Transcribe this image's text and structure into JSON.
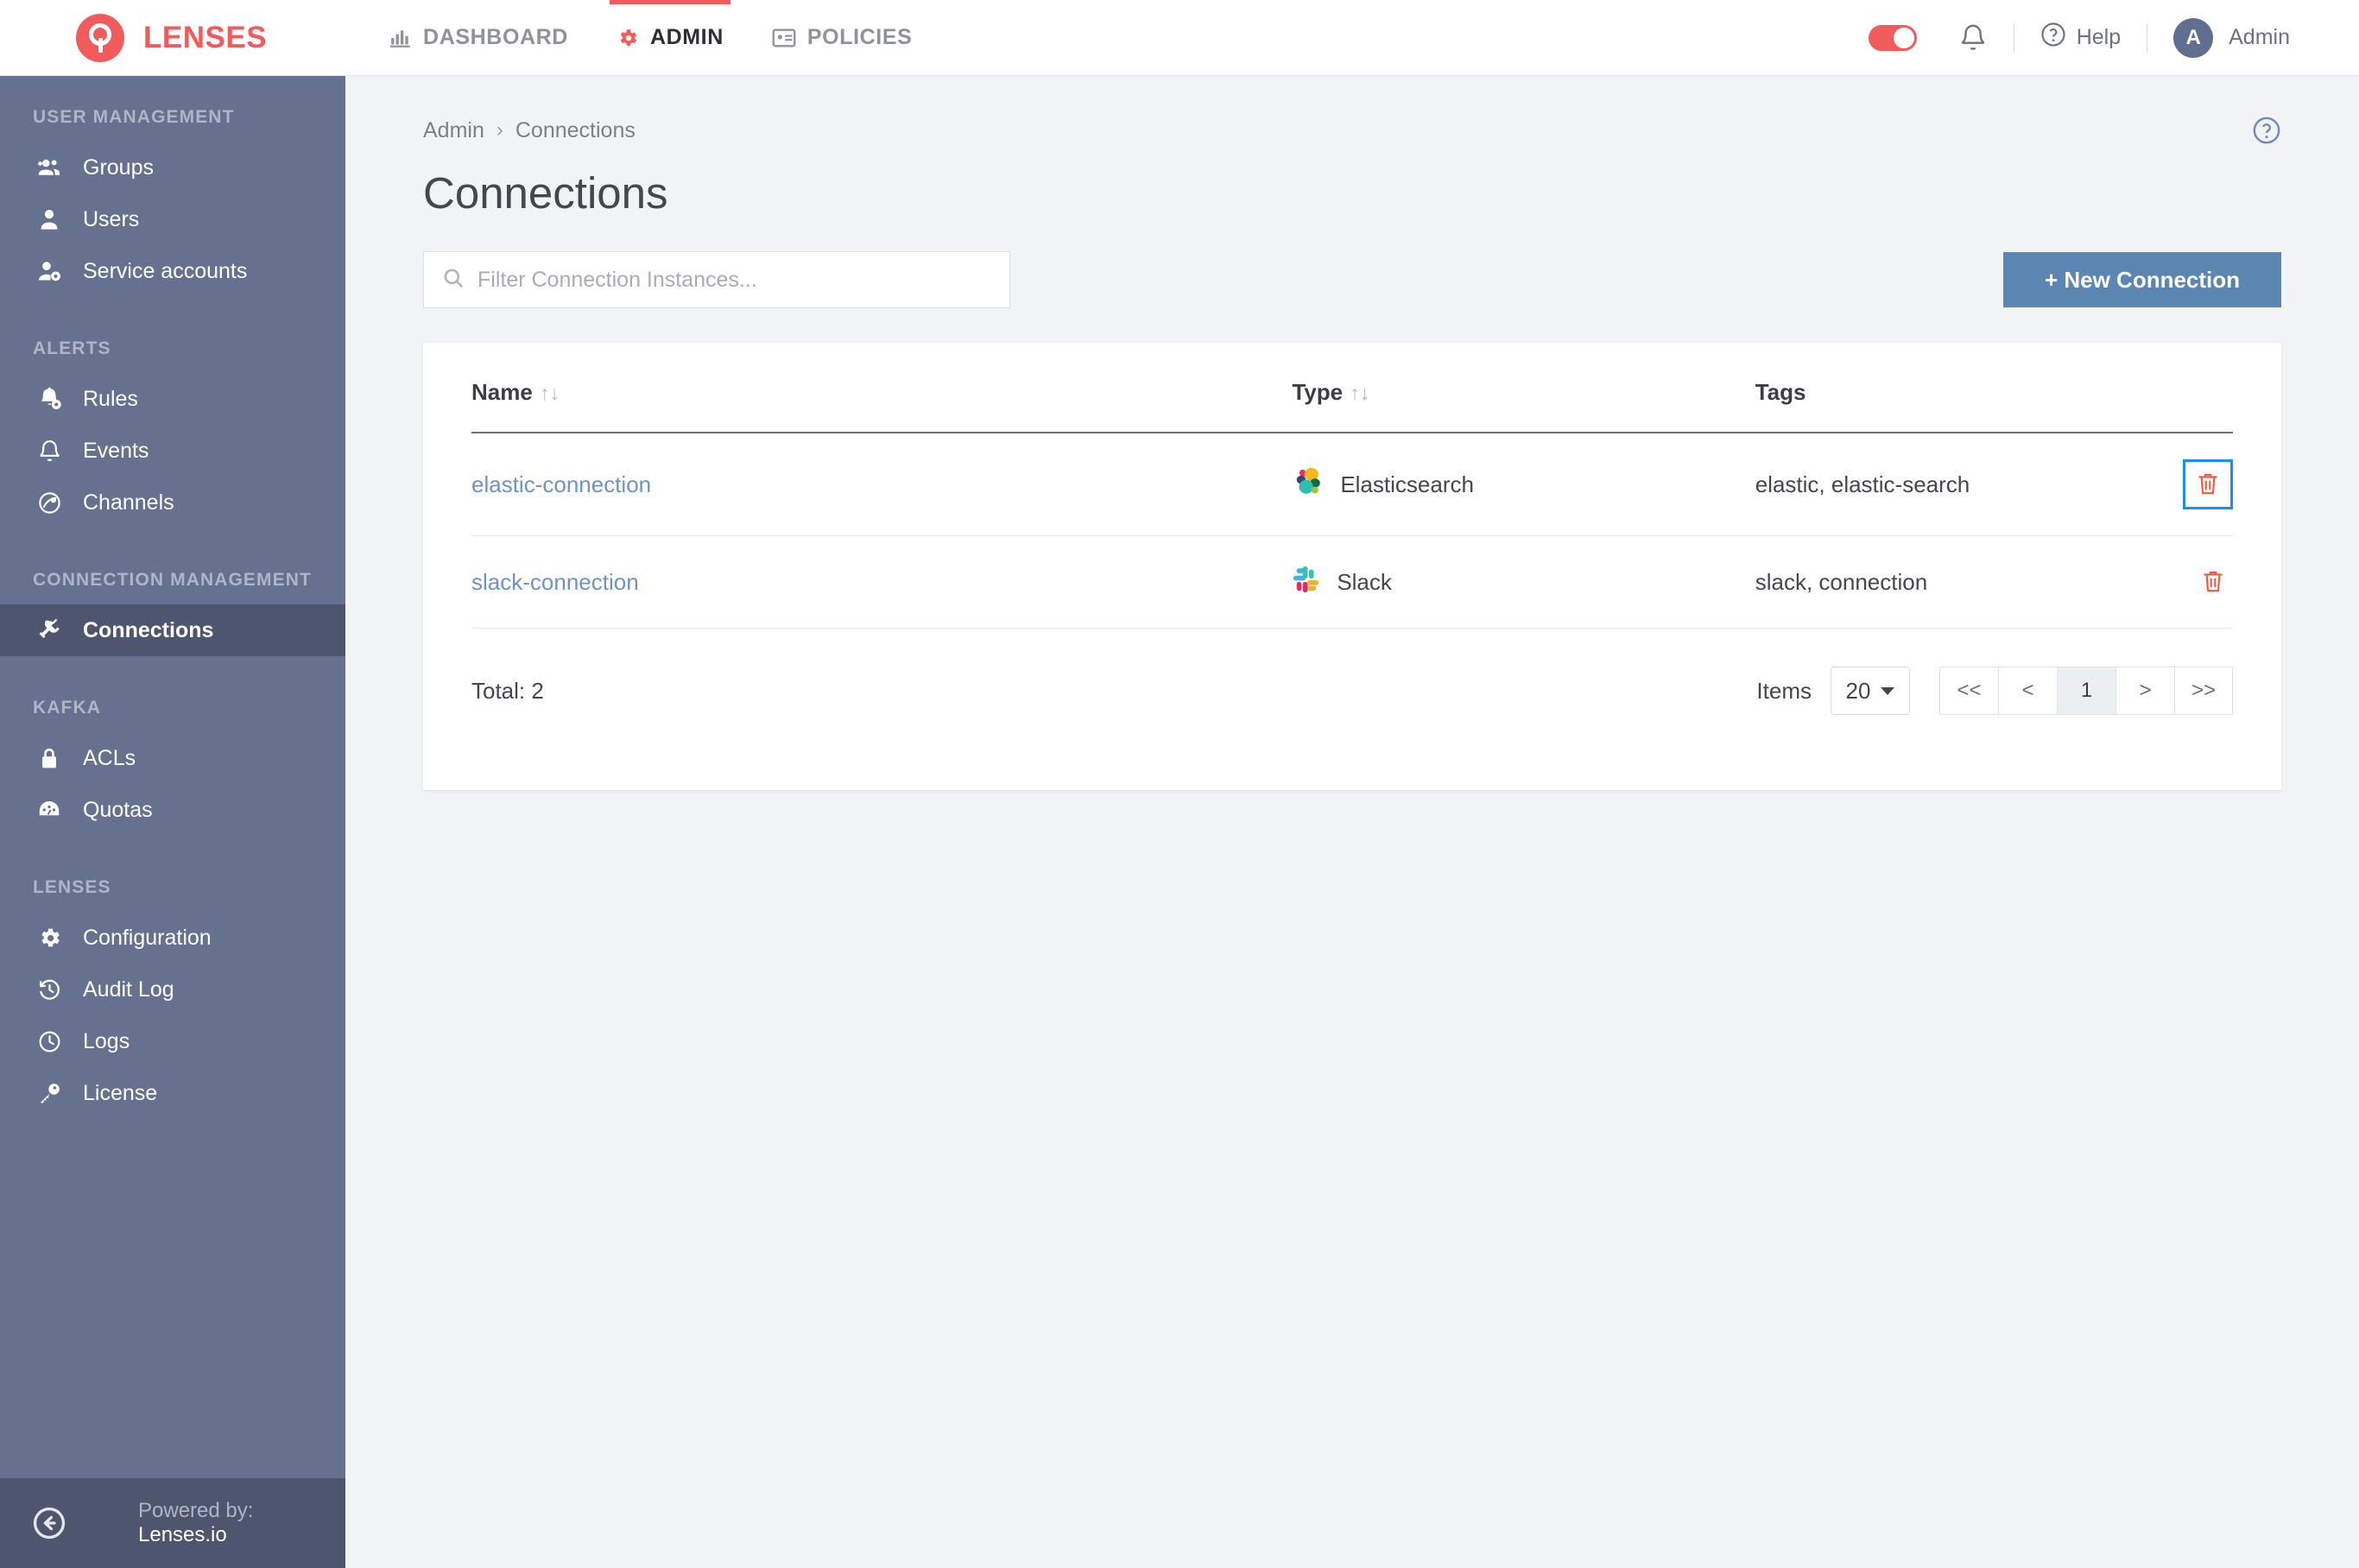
{
  "topbar": {
    "brand": "LENSES",
    "nav": [
      {
        "label": "DASHBOARD",
        "icon": "chart-bar-icon",
        "active": false
      },
      {
        "label": "ADMIN",
        "icon": "gear-icon",
        "active": true
      },
      {
        "label": "POLICIES",
        "icon": "id-card-icon",
        "active": false
      }
    ],
    "help_label": "Help",
    "user_initial": "A",
    "user_name": "Admin",
    "accent_color": "#f15b5b"
  },
  "sidebar": {
    "groups": [
      {
        "title": "USER MANAGEMENT",
        "items": [
          {
            "label": "Groups",
            "icon": "users-group-icon",
            "active": false
          },
          {
            "label": "Users",
            "icon": "user-icon",
            "active": false
          },
          {
            "label": "Service accounts",
            "icon": "user-gear-icon",
            "active": false
          }
        ]
      },
      {
        "title": "ALERTS",
        "items": [
          {
            "label": "Rules",
            "icon": "bell-gear-icon",
            "active": false
          },
          {
            "label": "Events",
            "icon": "bell-icon",
            "active": false
          },
          {
            "label": "Channels",
            "icon": "channels-icon",
            "active": false
          }
        ]
      },
      {
        "title": "CONNECTION MANAGEMENT",
        "items": [
          {
            "label": "Connections",
            "icon": "plug-icon",
            "active": true
          }
        ]
      },
      {
        "title": "KAFKA",
        "items": [
          {
            "label": "ACLs",
            "icon": "lock-icon",
            "active": false
          },
          {
            "label": "Quotas",
            "icon": "gauge-icon",
            "active": false
          }
        ]
      },
      {
        "title": "LENSES",
        "items": [
          {
            "label": "Configuration",
            "icon": "gear-icon",
            "active": false
          },
          {
            "label": "Audit Log",
            "icon": "history-icon",
            "active": false
          },
          {
            "label": "Logs",
            "icon": "clock-icon",
            "active": false
          },
          {
            "label": "License",
            "icon": "key-icon",
            "active": false
          }
        ]
      }
    ],
    "footer": {
      "collapse_icon": "collapse-left-icon",
      "powered_prefix": "Powered by: ",
      "powered_brand": "Lenses.io"
    },
    "bg_color": "#667190",
    "active_color": "#4d566e"
  },
  "main": {
    "breadcrumb": [
      "Admin",
      "Connections"
    ],
    "breadcrumb_separator": "›",
    "page_help_icon": "question-circle-icon",
    "title": "Connections",
    "search": {
      "icon": "search-icon",
      "placeholder": "Filter Connection Instances...",
      "value": ""
    },
    "new_button": "+ New Connection",
    "new_button_color": "#5c86b2",
    "table": {
      "columns": [
        {
          "label": "Name",
          "sortable": true
        },
        {
          "label": "Type",
          "sortable": true
        },
        {
          "label": "Tags",
          "sortable": false
        },
        {
          "label": "",
          "sortable": false
        }
      ],
      "sort_glyph": "↑↓",
      "rows": [
        {
          "name": "elastic-connection",
          "type": "Elasticsearch",
          "type_icon": "elasticsearch-logo",
          "tags": "elastic, elastic-search",
          "delete_icon": "trash-icon",
          "delete_focused": true
        },
        {
          "name": "slack-connection",
          "type": "Slack",
          "type_icon": "slack-logo",
          "tags": "slack, connection",
          "delete_icon": "trash-icon",
          "delete_focused": false
        }
      ]
    },
    "footer": {
      "total_label": "Total: 2",
      "items_label": "Items",
      "items_per_page": "20",
      "pages": [
        "<<",
        "<",
        "1",
        ">",
        ">>"
      ],
      "current_page": "1"
    }
  }
}
